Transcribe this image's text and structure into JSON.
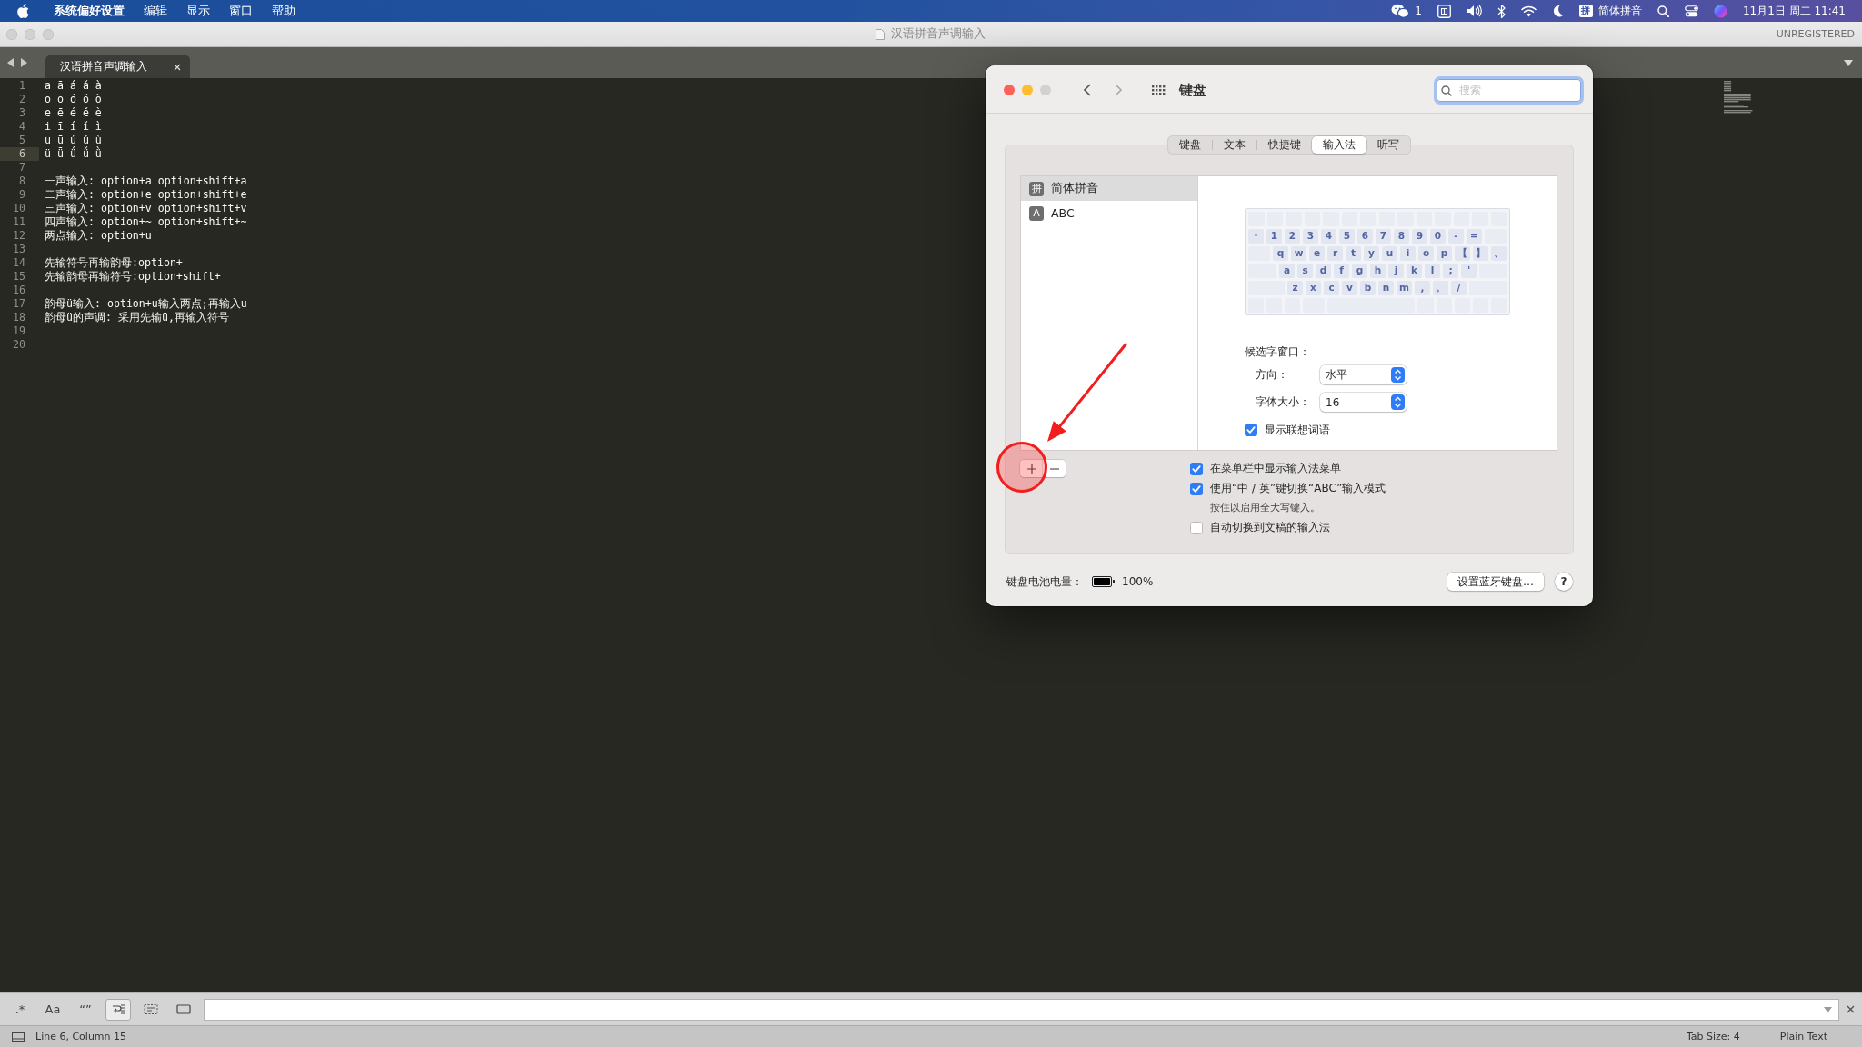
{
  "menu_bar": {
    "app": "系统偏好设置",
    "menus": [
      "编辑",
      "显示",
      "窗口",
      "帮助"
    ],
    "status_items": [
      {
        "kind": "wechat",
        "count": "1"
      },
      {
        "kind": "frame"
      },
      {
        "kind": "volume"
      },
      {
        "kind": "bluetooth"
      },
      {
        "kind": "wifi"
      },
      {
        "kind": "moon"
      },
      {
        "kind": "input",
        "badge": "拼",
        "label": "简体拼音"
      },
      {
        "kind": "search"
      },
      {
        "kind": "control"
      },
      {
        "kind": "orb"
      }
    ],
    "clock": "11月1日 周二 11:41"
  },
  "editor_window": {
    "title": "汉语拼音声调输入",
    "license": "UNREGISTERED",
    "tab": {
      "title": "汉语拼音声调输入"
    },
    "lines": [
      {
        "number": "1",
        "text": "a ā á ǎ à",
        "current": false
      },
      {
        "number": "2",
        "text": "o ō ó ǒ ò",
        "current": false
      },
      {
        "number": "3",
        "text": "e ē é ě è",
        "current": false
      },
      {
        "number": "4",
        "text": "i ī í ǐ ì",
        "current": false
      },
      {
        "number": "5",
        "text": "u ū ú ǔ ù",
        "current": false
      },
      {
        "number": "6",
        "text": "ü ǖ ǘ ǚ ǜ",
        "current": true
      },
      {
        "number": "7",
        "current": false
      },
      {
        "number": "8",
        "text": "一声输入: option+a option+shift+a",
        "current": false
      },
      {
        "number": "9",
        "text": "二声输入: option+e option+shift+e",
        "current": false
      },
      {
        "number": "10",
        "text": "三声输入: option+v option+shift+v",
        "current": false
      },
      {
        "number": "11",
        "text": "四声输入: option+~ option+shift+~",
        "current": false
      },
      {
        "number": "12",
        "text": "两点输入: option+u",
        "current": false
      },
      {
        "number": "13",
        "current": false
      },
      {
        "number": "14",
        "text": "先输符号再输韵母:option+",
        "current": false
      },
      {
        "number": "15",
        "text": "先输韵母再输符号:option+shift+",
        "current": false
      },
      {
        "number": "16",
        "current": false
      },
      {
        "number": "17",
        "text": "韵母ü输入: option+u输入两点;再输入u",
        "current": false
      },
      {
        "number": "18",
        "text": "韵母ü的声调: 采用先输ü,再输入符号",
        "current": false
      },
      {
        "number": "19",
        "current": false
      },
      {
        "number": "20",
        "current": false
      }
    ],
    "find_bar": {
      "toggles": [
        {
          "kind": "text",
          "label": ".*",
          "on": false
        },
        {
          "kind": "text",
          "label": "Aa",
          "on": false
        },
        {
          "kind": "text",
          "label": "“”",
          "on": false
        },
        {
          "kind": "wrap",
          "on": true
        },
        {
          "kind": "selection",
          "on": false
        },
        {
          "kind": "highlight",
          "on": false
        }
      ]
    },
    "status_bar": {
      "position": "Line 6, Column 15",
      "tab_size": "Tab Size: 4",
      "syntax": "Plain Text"
    }
  },
  "prefs_window": {
    "title": "键盘",
    "search": {
      "placeholder": "搜索"
    },
    "tabs": [
      {
        "label": "键盘",
        "selected": false
      },
      {
        "label": "文本",
        "selected": false
      },
      {
        "label": "快捷键",
        "selected": false
      },
      {
        "label": "输入法",
        "selected": true
      },
      {
        "label": "听写",
        "selected": false
      }
    ],
    "input_sources": [
      {
        "badge": "拼",
        "label": "简体拼音",
        "selected": true
      },
      {
        "badge": "A",
        "label": "ABC",
        "selected": false
      }
    ],
    "keyboard": {
      "rows": [
        {
          "kind": "function"
        },
        {
          "kind": "number",
          "keys": [
            "·",
            "1",
            "2",
            "3",
            "4",
            "5",
            "6",
            "7",
            "8",
            "9",
            "0",
            "-",
            "="
          ]
        },
        {
          "kind": "top",
          "keys": [
            "q",
            "w",
            "e",
            "r",
            "t",
            "y",
            "u",
            "i",
            "o",
            "p",
            "【",
            "】",
            "、"
          ]
        },
        {
          "kind": "home",
          "keys": [
            "a",
            "s",
            "d",
            "f",
            "g",
            "h",
            "j",
            "k",
            "l",
            ";",
            "'"
          ]
        },
        {
          "kind": "bottom",
          "keys": [
            "z",
            "x",
            "c",
            "v",
            "b",
            "n",
            "m",
            ",",
            "。",
            "/"
          ]
        },
        {
          "kind": "space"
        }
      ]
    },
    "candidate_window": {
      "heading": "候选字窗口：",
      "fields": [
        {
          "label": "方向：",
          "value": "水平"
        },
        {
          "label": "字体大小：",
          "value": "16"
        }
      ],
      "option": {
        "label": "显示联想词语",
        "checked": true
      }
    },
    "options": [
      {
        "label": "在菜单栏中显示输入法菜单",
        "checked": true
      },
      {
        "label": "使用“中 / 英”键切换“ABC”输入模式",
        "checked": true,
        "hint": "按住以启用全大写键入。"
      },
      {
        "label": "自动切换到文稿的输入法",
        "checked": false
      }
    ],
    "battery": {
      "label": "键盘电池电量：",
      "level": 1,
      "reading": "100%"
    },
    "buttons": [
      {
        "kind": "push",
        "label": "设置蓝牙键盘…"
      },
      {
        "kind": "help",
        "label": "?"
      }
    ]
  }
}
